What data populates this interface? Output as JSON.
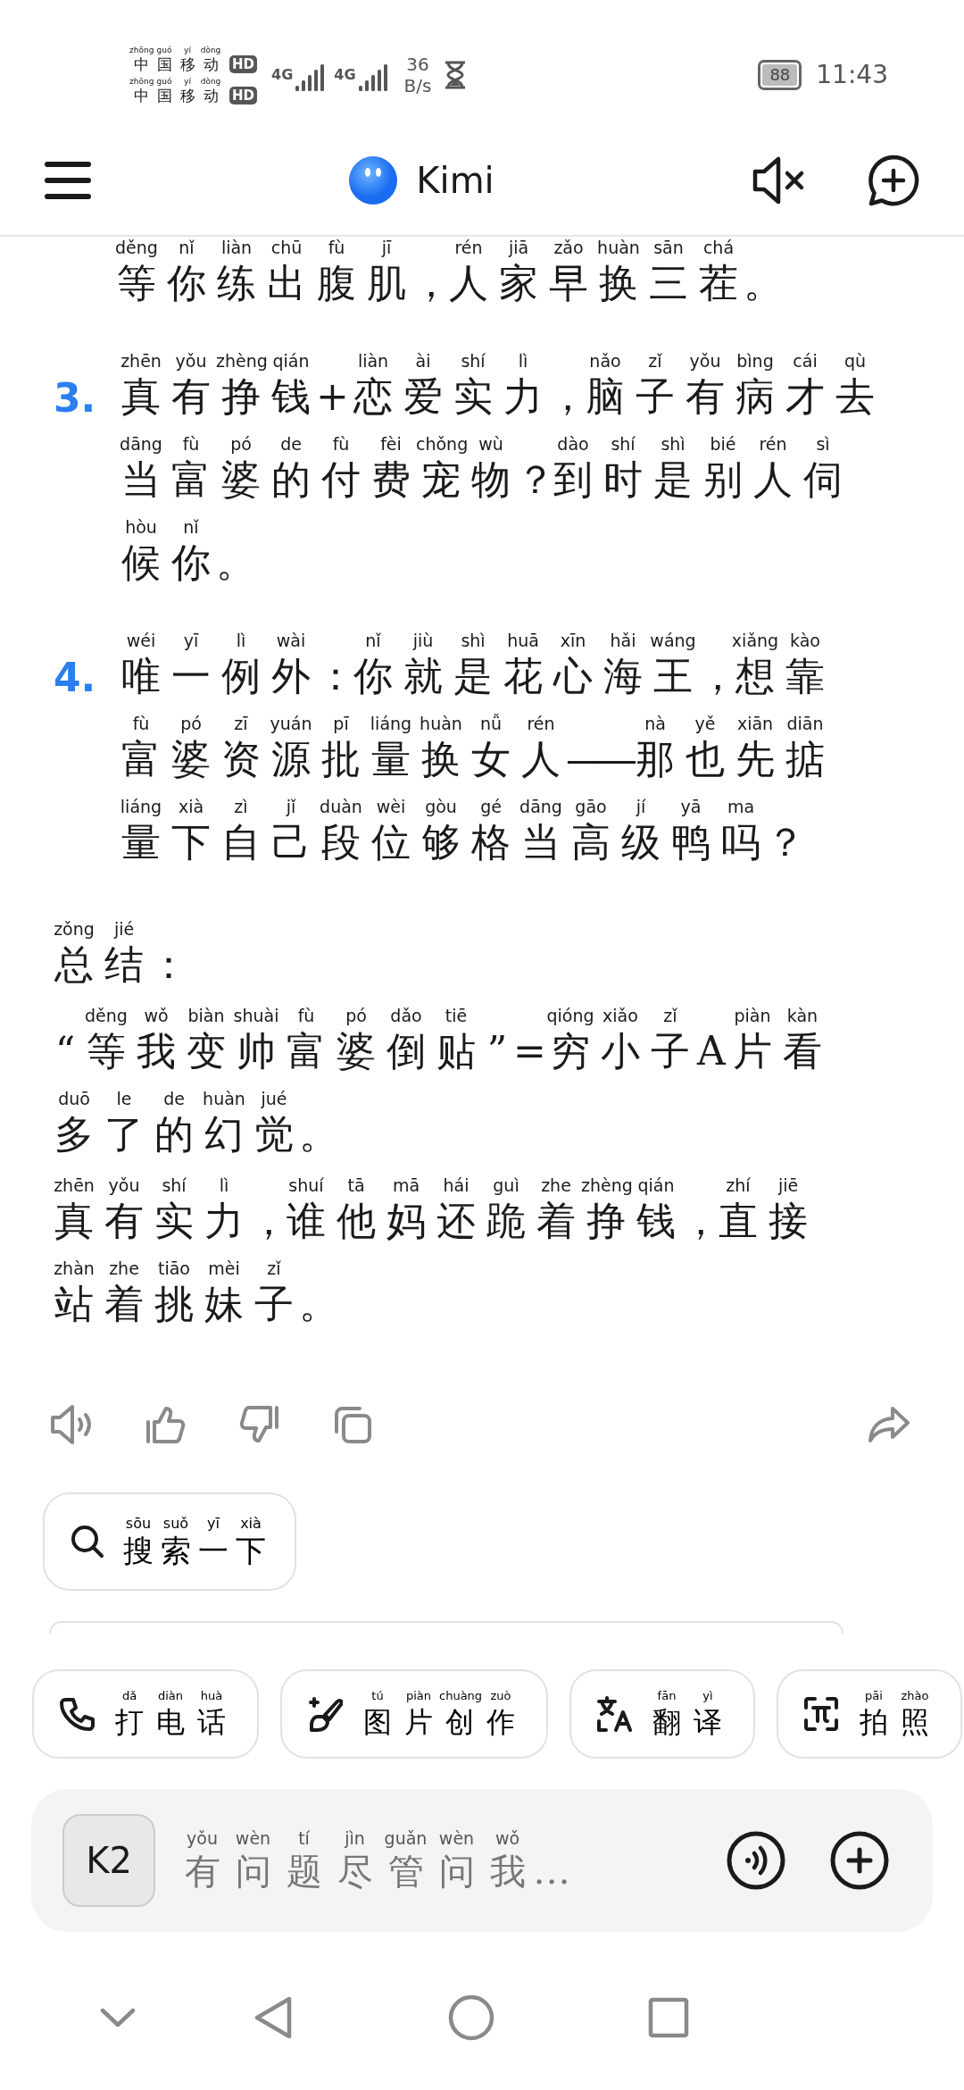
{
  "status_bar": {
    "carriers": [
      {
        "name": "中国移动",
        "pinyin": "zhōng guó yí dòng",
        "badge": "HD"
      },
      {
        "name": "中国移动",
        "pinyin": "zhōng guó yí dòng",
        "badge": "HD"
      }
    ],
    "networks": [
      {
        "label": "4G"
      },
      {
        "label": "4G"
      }
    ],
    "speed_value": "36",
    "speed_unit": "B/s",
    "battery": "88",
    "time": "11:43"
  },
  "header": {
    "title": "Kimi"
  },
  "message": {
    "blocks": [
      {
        "kind": "continuation",
        "lines": [
          {
            "text": "等你练出腹肌，人家早换三茬。",
            "pinyin": "děng nǐ liàn chū fù jī rén jiā zǎo huàn sān chá"
          }
        ]
      },
      {
        "kind": "list_item",
        "number": "3.",
        "lines": [
          {
            "text": "真有挣钱+恋爱实力，脑子有病才去",
            "pinyin": "zhēn yǒu zhèng qián liàn ài shí lì nǎo zǐ yǒu bìng cái qù"
          },
          {
            "text": "当富婆的付费宠物？到时是别人伺",
            "pinyin": "dāng fù pó de fù fèi chǒng wù dào shí shì bié rén sì"
          },
          {
            "text": "候你。",
            "pinyin": "hòu nǐ"
          }
        ]
      },
      {
        "kind": "list_item",
        "number": "4.",
        "lines": [
          {
            "text": "唯一例外：你就是花心海王，想靠",
            "pinyin": "wéi yī lì wài nǐ jiù shì huā xīn hǎi wáng xiǎng kào"
          },
          {
            "text": "富婆资源批量换女人——那也先掂",
            "pinyin": "fù pó zī yuán pī liáng huàn nǚ rén nà yě xiān diān"
          },
          {
            "text": "量下自己段位够格当高级鸭吗？",
            "pinyin": "liáng xià zì jǐ duàn wèi gòu gé dāng gāo jí yā ma"
          }
        ]
      },
      {
        "kind": "heading",
        "lines": [
          {
            "text": "总结：",
            "pinyin": "zǒng jié"
          }
        ]
      },
      {
        "kind": "paragraph",
        "lines": [
          {
            "text": "“等我变帅富婆倒贴”=穷小子A片看",
            "pinyin": "děng wǒ biàn shuài fù pó dǎo tiē qióng xiǎo zǐ piàn kàn"
          },
          {
            "text": "多了的幻觉。",
            "pinyin": "duō le de huàn jué"
          }
        ]
      },
      {
        "kind": "paragraph",
        "lines": [
          {
            "text": "真有实力，谁他妈还跪着挣钱，直接",
            "pinyin": "zhēn yǒu shí lì shuí tā mā hái guì zhe zhèng qián zhí jiē"
          },
          {
            "text": "站着挑妹子。",
            "pinyin": "zhàn zhe tiāo mèi zǐ"
          }
        ]
      }
    ]
  },
  "search_button": {
    "text": "搜索一下",
    "pinyin": "sōu suǒ yī xià"
  },
  "shortcuts": [
    {
      "kind": "call",
      "text": "打电话",
      "pinyin": "dǎ diàn huà"
    },
    {
      "kind": "image",
      "text": "图片创作",
      "pinyin": "tú piàn chuàng zuò"
    },
    {
      "kind": "translate",
      "text": "翻译",
      "pinyin": "fān yì"
    },
    {
      "kind": "photo",
      "text": "拍照",
      "pinyin": "pāi zhào"
    }
  ],
  "composer": {
    "model": "K2",
    "placeholder": {
      "text": "有问题尽管问我...",
      "pinyin": "yǒu wèn tí jìn guǎn wèn wǒ"
    }
  }
}
